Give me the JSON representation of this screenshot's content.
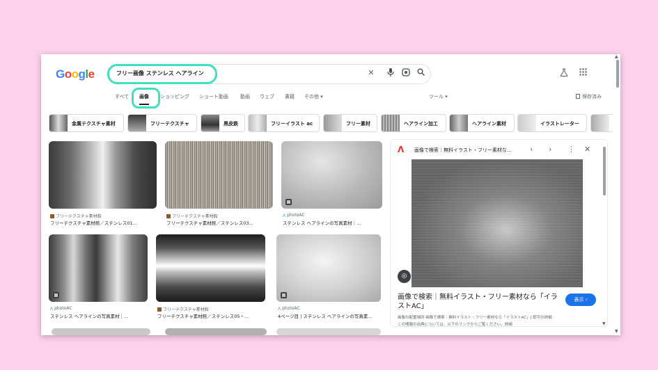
{
  "logo": {
    "letters": [
      "G",
      "o",
      "o",
      "g",
      "l",
      "e"
    ],
    "colors": [
      "#4285f4",
      "#ea4335",
      "#fbbc05",
      "#4285f4",
      "#34a853",
      "#ea4335"
    ]
  },
  "search": {
    "query": "フリー画像 ステンレス ヘアライン"
  },
  "icons": {
    "clear": "close-icon",
    "mic": "mic-icon",
    "lens": "lens-icon",
    "search": "search-icon",
    "labs": "flask-icon",
    "apps": "apps-grid-icon",
    "saved": "bookmark-icon"
  },
  "tabs": {
    "items": [
      "すべて",
      "画像",
      "ショッピング",
      "ショート動画",
      "動画",
      "ウェブ",
      "書籍",
      "その他 ▾"
    ],
    "active": "画像",
    "tools": "ツール ▾",
    "saved": "保存済み"
  },
  "chips": [
    "金属テクスチャ素材",
    "フリーテクスチャ",
    "黒皮鉄",
    "フリーイラスト ac",
    "フリー素材",
    "ヘアライン加工",
    "ヘアライン素材",
    "イラストレーター"
  ],
  "results": [
    {
      "source": "フリーテクスチャ素材館",
      "caption": "フリーテクスチャ素材館／ステンレス01..."
    },
    {
      "source": "フリーテクスチャ素材館",
      "caption": "フリーテクスチャ素材館／ステンレス03..."
    },
    {
      "source": "photoAC",
      "caption": "ステンレス ヘアラインの写真素材｜..."
    },
    {
      "source": "photoAC",
      "caption": "ステンレス ヘアラインの写真素材｜..."
    },
    {
      "source": "フリーテクスチャ素材館",
      "caption": "フリーテクスチャ素材館／ステンレス05・..."
    },
    {
      "source": "photoAC",
      "caption": "4ページ目 | ステンレス ヘアラインの写真素..."
    }
  ],
  "panel": {
    "title": "画像で検索｜無料イラスト・フリー素材な...",
    "heading": "画像で検索｜無料イラスト・フリー素材なら「イラストAC」",
    "show_button": "表示 ›",
    "meta": "画像の配置場所 画像で検索｜無料イラスト・フリー素材なら「イラストAC」| 認可の詳細",
    "meta2": "この情報の出典については、以下のリンクからご覧ください。詳細"
  }
}
